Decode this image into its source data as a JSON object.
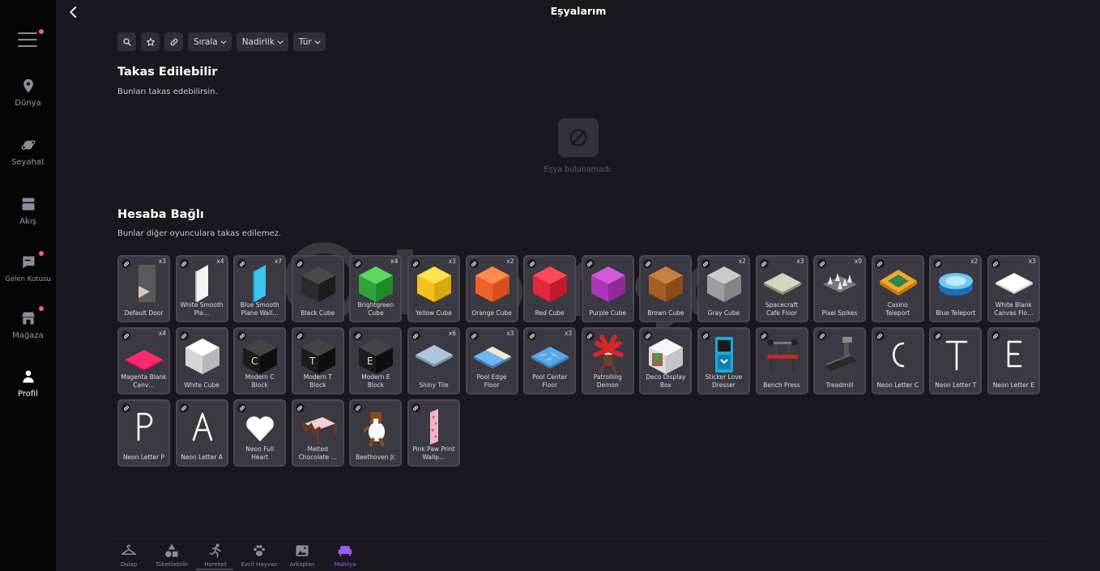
{
  "title": "Eşyalarım",
  "sidebar": {
    "items": [
      {
        "label": "Dünya"
      },
      {
        "label": "Seyahat"
      },
      {
        "label": "Akış"
      },
      {
        "label": "Gelen Kutusu"
      },
      {
        "label": "Mağaza"
      },
      {
        "label": "Profil"
      }
    ]
  },
  "filters": {
    "sort_label": "Sırala",
    "rarity_label": "Nadirlik",
    "type_label": "Tür"
  },
  "tradable": {
    "title": "Takas Edilebilir",
    "subtitle": "Bunları takas edebilirsin.",
    "empty_text": "Eşya bulunamadı."
  },
  "bound": {
    "title": "Hesaba Bağlı",
    "subtitle": "Bunlar diğer oyunculara takas edilemez.",
    "items": [
      {
        "name": "Default Door",
        "qty": "x3"
      },
      {
        "name": "White Smooth Pla…",
        "qty": "x4"
      },
      {
        "name": "Blue Smooth Plane Wall…",
        "qty": "x7"
      },
      {
        "name": "Black Cube",
        "qty": ""
      },
      {
        "name": "Brightgreen Cube",
        "qty": "x4"
      },
      {
        "name": "Yellow Cube",
        "qty": "x3"
      },
      {
        "name": "Orange Cube",
        "qty": "x2"
      },
      {
        "name": "Red Cube",
        "qty": ""
      },
      {
        "name": "Purple Cube",
        "qty": ""
      },
      {
        "name": "Brown Cube",
        "qty": ""
      },
      {
        "name": "Gray Cube",
        "qty": "x2"
      },
      {
        "name": "Spacecraft Cafe Floor",
        "qty": "x3"
      },
      {
        "name": "Pixel Spikes",
        "qty": "x9"
      },
      {
        "name": "Casino Teleport",
        "qty": ""
      },
      {
        "name": "Blue Teleport",
        "qty": "x2"
      },
      {
        "name": "White Blank Canvas Flo…",
        "qty": "x3"
      },
      {
        "name": "Magenta Blank Canv…",
        "qty": "x4"
      },
      {
        "name": "White Cube",
        "qty": ""
      },
      {
        "name": "Modern C Block",
        "qty": ""
      },
      {
        "name": "Modern T Block",
        "qty": ""
      },
      {
        "name": "Modern E Block",
        "qty": ""
      },
      {
        "name": "Shiny Tile",
        "qty": "x6"
      },
      {
        "name": "Pool Edge Floor",
        "qty": "x3"
      },
      {
        "name": "Pool Center Floor",
        "qty": "x3"
      },
      {
        "name": "Patrolling Demon",
        "qty": ""
      },
      {
        "name": "Deco Display Box",
        "qty": ""
      },
      {
        "name": "Sticker Love Dresser",
        "qty": ""
      },
      {
        "name": "Bench Press",
        "qty": ""
      },
      {
        "name": "Treadmill",
        "qty": ""
      },
      {
        "name": "Neon Letter C",
        "qty": ""
      },
      {
        "name": "Neon Letter T",
        "qty": ""
      },
      {
        "name": "Neon Letter E",
        "qty": ""
      },
      {
        "name": "Neon Letter P",
        "qty": ""
      },
      {
        "name": "Neon Letter A",
        "qty": ""
      },
      {
        "name": "Neon Full Heart",
        "qty": ""
      },
      {
        "name": "Melted Chocolate …",
        "qty": ""
      },
      {
        "name": "Beethoven Jr.",
        "qty": ""
      },
      {
        "name": "Pink Paw Print Wallp…",
        "qty": ""
      }
    ]
  },
  "tabs": [
    {
      "label": "Dolap"
    },
    {
      "label": "Tüketilebilir"
    },
    {
      "label": "Hareket"
    },
    {
      "label": "Evcil Hayvan"
    },
    {
      "label": "Arkaplan"
    },
    {
      "label": "Mobilya"
    }
  ],
  "colors": {
    "accent": "#9a5cff",
    "notification": "#ff5a8a",
    "sidebar_bg": "#050506",
    "page_bg": "#1a181e",
    "card_bg": "#3b3942"
  }
}
